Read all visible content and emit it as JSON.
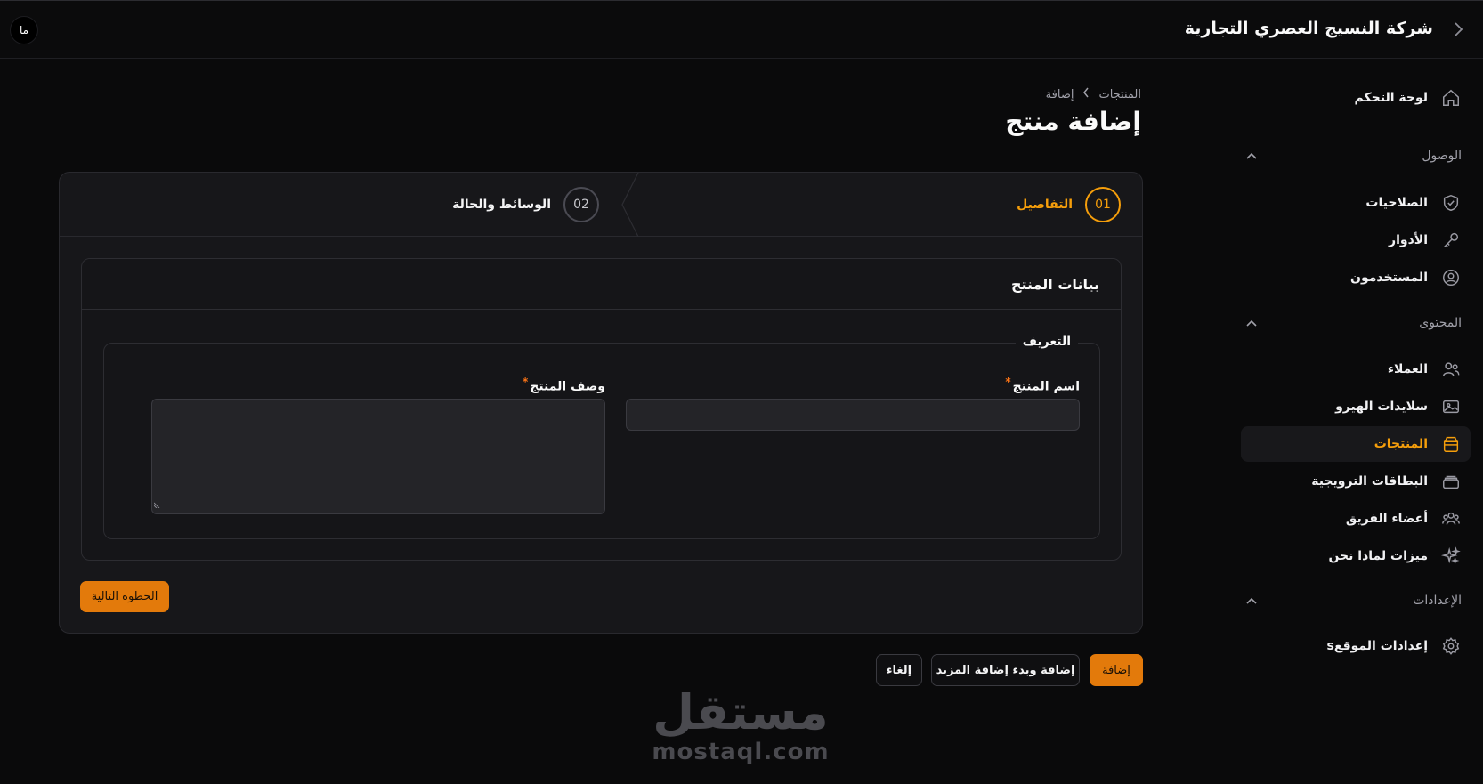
{
  "header": {
    "brand": "شركة النسيج العصري التجارية",
    "avatar_initials": "ما"
  },
  "sidebar": {
    "dashboard": "لوحة التحكم",
    "groups": {
      "access": "الوصول",
      "content": "المحتوى",
      "settings": "الإعدادات"
    },
    "items": {
      "permissions": "الصلاحيات",
      "roles": "الأدوار",
      "users": "المستخدمون",
      "clients": "العملاء",
      "hero_slides": "سلايدات الهيرو",
      "products": "المنتجات",
      "promo_cards": "البطاقات الترويجية",
      "team_members": "أعضاء الفريق",
      "why_us": "ميزات لماذا نحن",
      "site_settings": "إعدادات الموقعs"
    },
    "active_item": "products"
  },
  "breadcrumb": {
    "parent": "المنتجات",
    "current": "إضافة"
  },
  "page_title": "إضافة منتج",
  "stepper": {
    "steps": [
      {
        "number": "01",
        "label": "التفاصيل",
        "state": "current"
      },
      {
        "number": "02",
        "label": "الوسائط والحالة",
        "state": "upcoming"
      }
    ]
  },
  "form": {
    "section_title": "بيانات المنتج",
    "fieldset_legend": "التعريف",
    "name_label": "اسم المنتج",
    "name_value": "",
    "description_label": "وصف المنتج",
    "description_value": "",
    "required_mark": "*",
    "next_step": "الخطوة التالية"
  },
  "actions": {
    "add": "إضافة",
    "add_and_more": "إضافة وبدء إضافة المزيد",
    "cancel": "إلغاء"
  },
  "watermark": {
    "arabic": "مستقل",
    "latin": "mostaql.com"
  },
  "colors": {
    "accent": "#f59e0b",
    "button": "#e37a0b",
    "background": "#0a0a0b",
    "card": "#17171a"
  }
}
